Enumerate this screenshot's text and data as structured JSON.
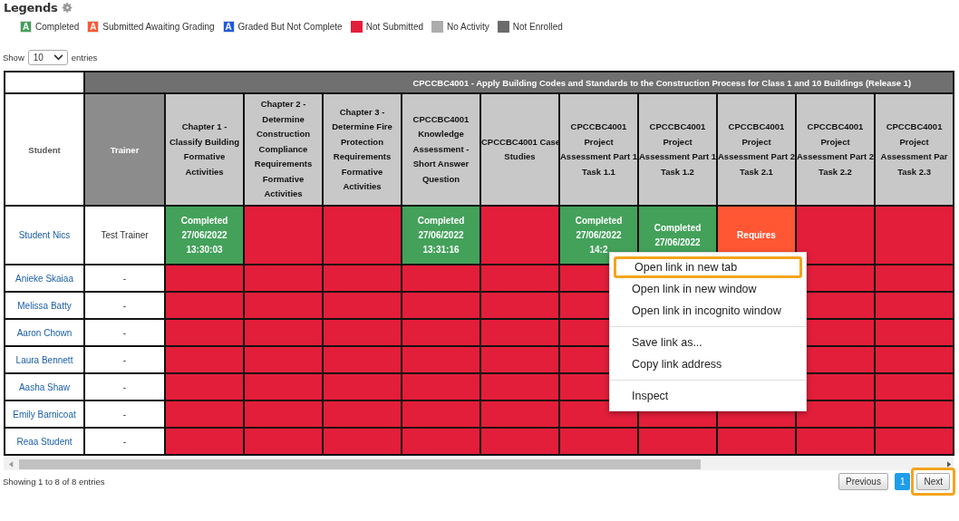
{
  "legends": {
    "title": "Legends",
    "items": [
      {
        "kind": "lettered",
        "letter": "A",
        "label": "Completed",
        "color": "#43a15a"
      },
      {
        "kind": "lettered",
        "letter": "A",
        "label": "Submitted Awaiting Grading",
        "color": "#ff5733"
      },
      {
        "kind": "lettered",
        "letter": "A",
        "label": "Graded But Not Complete",
        "color": "#1f5ae0"
      },
      {
        "kind": "swatch",
        "label": "Not Submitted",
        "color": "#e31e3a"
      },
      {
        "kind": "swatch",
        "label": "No Activity",
        "color": "#adadad"
      },
      {
        "kind": "swatch",
        "label": "Not Enrolled",
        "color": "#6b6b6b"
      }
    ]
  },
  "length_menu": {
    "prefix": "Show",
    "value": "10",
    "suffix": "entries"
  },
  "table": {
    "unit_title": "CPCCBC4001 - Apply Building Codes and Standards to the Construction Process for Class 1 and 10 Buildings (Release 1)",
    "student_heading": "Student",
    "trainer_heading": "Trainer",
    "columns": [
      {
        "lines": [
          "Chapter 1 -",
          "Classify Building",
          "Formative",
          "Activities"
        ]
      },
      {
        "lines": [
          "Chapter 2 -",
          "Determine",
          "Construction",
          "Compliance",
          "Requirements",
          "Formative",
          "Activities"
        ]
      },
      {
        "lines": [
          "Chapter 3 -",
          "Determine Fire",
          "Protection",
          "Requirements",
          "Formative",
          "Activities"
        ]
      },
      {
        "lines": [
          "CPCCBC4001",
          "Knowledge",
          "Assessment -",
          "Short Answer",
          "Question"
        ]
      },
      {
        "lines": [
          "CPCCBC4001 Case",
          "Studies"
        ]
      },
      {
        "lines": [
          "CPCCBC4001",
          "Project",
          "Assessment Part 1",
          "Task 1.1"
        ]
      },
      {
        "lines": [
          "CPCCBC4001",
          "Project",
          "Assessment Part 1",
          "Task 1.2"
        ]
      },
      {
        "lines": [
          "CPCCBC4001",
          "Project",
          "Assessment Part 2",
          "Task 2.1"
        ]
      },
      {
        "lines": [
          "CPCCBC4001",
          "Project",
          "Assessment Part 2",
          "Task 2.2"
        ]
      },
      {
        "lines": [
          "CPCCBC4001",
          "Project",
          "Assessment Par",
          "Task 2.3"
        ]
      }
    ],
    "rows": [
      {
        "student": "Student Nics",
        "trainer": "Test Trainer",
        "cells": [
          {
            "color": "#43a15a",
            "lines": [
              "Completed",
              "27/06/2022",
              "13:30:03"
            ]
          },
          {
            "color": "#e31e3a"
          },
          {
            "color": "#e31e3a"
          },
          {
            "color": "#43a15a",
            "lines": [
              "Completed",
              "27/06/2022",
              "13:31:16"
            ]
          },
          {
            "color": "#e31e3a"
          },
          {
            "color": "#43a15a",
            "lines": [
              "Completed",
              "27/06/2022",
              "14:2"
            ]
          },
          {
            "color": "#43a15a",
            "lines": [
              "Completed",
              "27/06/2022"
            ]
          },
          {
            "color": "#ff5733",
            "lines": [
              "Requires"
            ]
          },
          {
            "color": "#e31e3a"
          },
          {
            "color": "#e31e3a"
          }
        ]
      },
      {
        "student": "Anieke Skaiaa",
        "trainer": "-",
        "cells": [
          {
            "color": "#e31e3a"
          },
          {
            "color": "#e31e3a"
          },
          {
            "color": "#e31e3a"
          },
          {
            "color": "#e31e3a"
          },
          {
            "color": "#e31e3a"
          },
          {
            "color": "#e31e3a"
          },
          {},
          {},
          {
            "color": "#e31e3a"
          },
          {
            "color": "#e31e3a"
          }
        ]
      },
      {
        "student": "Melissa Batty",
        "trainer": "-",
        "cells": [
          {
            "color": "#e31e3a"
          },
          {
            "color": "#e31e3a"
          },
          {
            "color": "#e31e3a"
          },
          {
            "color": "#e31e3a"
          },
          {
            "color": "#e31e3a"
          },
          {
            "color": "#e31e3a"
          },
          {},
          {},
          {
            "color": "#e31e3a"
          },
          {
            "color": "#e31e3a"
          }
        ]
      },
      {
        "student": "Aaron Chown",
        "trainer": "-",
        "cells": [
          {
            "color": "#e31e3a"
          },
          {
            "color": "#e31e3a"
          },
          {
            "color": "#e31e3a"
          },
          {
            "color": "#e31e3a"
          },
          {
            "color": "#e31e3a"
          },
          {
            "color": "#e31e3a"
          },
          {},
          {},
          {
            "color": "#e31e3a"
          },
          {
            "color": "#e31e3a"
          }
        ]
      },
      {
        "student": "Laura Bennett",
        "trainer": "-",
        "cells": [
          {
            "color": "#e31e3a"
          },
          {
            "color": "#e31e3a"
          },
          {
            "color": "#e31e3a"
          },
          {
            "color": "#e31e3a"
          },
          {
            "color": "#e31e3a"
          },
          {
            "color": "#e31e3a"
          },
          {},
          {},
          {
            "color": "#e31e3a"
          },
          {
            "color": "#e31e3a"
          }
        ]
      },
      {
        "student": "Aasha Shaw",
        "trainer": "-",
        "cells": [
          {
            "color": "#e31e3a"
          },
          {
            "color": "#e31e3a"
          },
          {
            "color": "#e31e3a"
          },
          {
            "color": "#e31e3a"
          },
          {
            "color": "#e31e3a"
          },
          {
            "color": "#e31e3a"
          },
          {},
          {},
          {
            "color": "#e31e3a"
          },
          {
            "color": "#e31e3a"
          }
        ]
      },
      {
        "student": "Emily Barnicoat",
        "trainer": "-",
        "cells": [
          {
            "color": "#e31e3a"
          },
          {
            "color": "#e31e3a"
          },
          {
            "color": "#e31e3a"
          },
          {
            "color": "#e31e3a"
          },
          {
            "color": "#e31e3a"
          },
          {
            "color": "#e31e3a"
          },
          {
            "color": "#e31e3a"
          },
          {
            "color": "#e31e3a"
          },
          {
            "color": "#e31e3a"
          },
          {
            "color": "#e31e3a"
          }
        ]
      },
      {
        "student": "Reaa Student",
        "trainer": "-",
        "cells": [
          {
            "color": "#e31e3a"
          },
          {
            "color": "#e31e3a"
          },
          {
            "color": "#e31e3a"
          },
          {
            "color": "#e31e3a"
          },
          {
            "color": "#e31e3a"
          },
          {
            "color": "#e31e3a"
          },
          {
            "color": "#e31e3a"
          },
          {
            "color": "#e31e3a"
          },
          {
            "color": "#e31e3a"
          },
          {
            "color": "#e31e3a"
          }
        ]
      }
    ]
  },
  "context_menu": {
    "groups": [
      [
        {
          "label": "Open link in new tab",
          "highlighted": true
        },
        {
          "label": "Open link in new window",
          "highlighted": false
        },
        {
          "label": "Open link in incognito window",
          "highlighted": false
        }
      ],
      [
        {
          "label": "Save link as...",
          "highlighted": false
        },
        {
          "label": "Copy link address",
          "highlighted": false
        }
      ],
      [
        {
          "label": "Inspect",
          "highlighted": false
        }
      ]
    ]
  },
  "footer": {
    "info": "Showing 1 to 8 of 8 entries",
    "pages": [
      {
        "kind": "button",
        "label": "Previous",
        "selected": false,
        "highlighted": false
      },
      {
        "kind": "page",
        "label": "1",
        "selected": true,
        "highlighted": false
      },
      {
        "kind": "button",
        "label": "Next",
        "selected": false,
        "highlighted": true
      }
    ]
  }
}
